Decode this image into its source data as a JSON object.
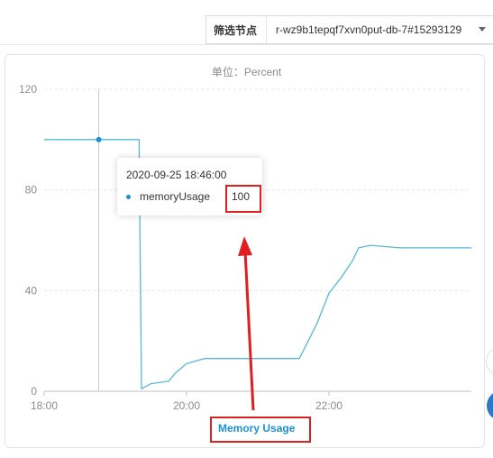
{
  "filter": {
    "label": "筛选节点",
    "value": "r-wz9b1tepqf7xvn0put-db-7#15293129"
  },
  "unit_label": "单位：Percent",
  "tooltip": {
    "time": "2020-09-25 18:46:00",
    "series": "memoryUsage",
    "value": "100"
  },
  "legend_label": "Memory Usage",
  "chart_data": {
    "type": "line",
    "title": "单位：Percent",
    "xlabel": "",
    "ylabel": "",
    "xlim": [
      "18:00",
      "24:00"
    ],
    "ylim": [
      0,
      120
    ],
    "x_ticks": [
      "18:00",
      "20:00",
      "22:00"
    ],
    "y_ticks": [
      "0",
      "40",
      "80",
      "120"
    ],
    "grid": true,
    "legend_position": "bottom",
    "series": [
      {
        "name": "Memory Usage",
        "color": "#57b8d8",
        "x": [
          "18:00",
          "18:46",
          "19:00",
          "19:20",
          "19:22",
          "19:30",
          "19:45",
          "19:50",
          "20:00",
          "20:15",
          "20:25",
          "20:30",
          "20:45",
          "21:00",
          "21:15",
          "21:35",
          "21:50",
          "22:00",
          "22:10",
          "22:20",
          "22:25",
          "22:35",
          "23:00",
          "23:30",
          "24:00"
        ],
        "values": [
          100,
          100,
          100,
          100,
          1,
          3,
          4,
          7,
          11,
          13,
          13,
          13,
          13,
          13,
          13,
          13,
          27,
          39,
          45,
          52,
          57,
          58,
          57,
          57,
          57
        ]
      }
    ]
  },
  "colors": {
    "line": "#57b8d8",
    "accent": "#1b93d6",
    "highlight": "#e02020"
  }
}
